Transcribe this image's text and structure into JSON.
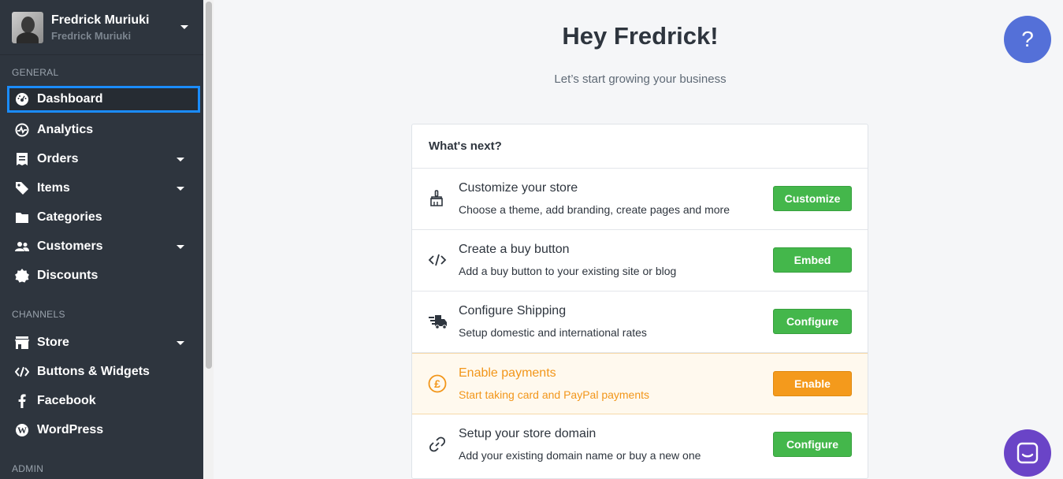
{
  "user": {
    "name": "Fredrick Muriuki",
    "subname": "Fredrick Muriuki"
  },
  "sidebar": {
    "general_label": "GENERAL",
    "channels_label": "CHANNELS",
    "admin_label": "ADMIN",
    "general_items": [
      {
        "label": "Dashboard",
        "icon": "dashboard-icon",
        "active": true
      },
      {
        "label": "Analytics",
        "icon": "analytics-icon"
      },
      {
        "label": "Orders",
        "icon": "orders-icon",
        "dropdown": true
      },
      {
        "label": "Items",
        "icon": "tag-icon",
        "dropdown": true
      },
      {
        "label": "Categories",
        "icon": "folder-icon"
      },
      {
        "label": "Customers",
        "icon": "customers-icon",
        "dropdown": true
      },
      {
        "label": "Discounts",
        "icon": "discount-badge-icon"
      }
    ],
    "channel_items": [
      {
        "label": "Store",
        "icon": "store-icon",
        "dropdown": true
      },
      {
        "label": "Buttons & Widgets",
        "icon": "code-icon"
      },
      {
        "label": "Facebook",
        "icon": "facebook-icon"
      },
      {
        "label": "WordPress",
        "icon": "wordpress-icon"
      }
    ]
  },
  "main": {
    "greeting": "Hey Fredrick!",
    "subtitle": "Let’s start growing your business",
    "card_title": "What's next?",
    "rows": [
      {
        "title": "Customize your store",
        "desc": "Choose a theme, add branding, create pages and more",
        "button": "Customize",
        "icon": "paintbrush-icon"
      },
      {
        "title": "Create a buy button",
        "desc": "Add a buy button to your existing site or blog",
        "button": "Embed",
        "icon": "code-icon"
      },
      {
        "title": "Configure Shipping",
        "desc": "Setup domestic and international rates",
        "button": "Configure",
        "icon": "shipping-truck-icon"
      },
      {
        "title": "Enable payments",
        "desc": "Start taking card and PayPal payments",
        "button": "Enable",
        "icon": "pound-coin-icon",
        "highlight": true
      },
      {
        "title": "Setup your store domain",
        "desc": "Add your existing domain name or buy a new one",
        "button": "Configure",
        "icon": "link-icon"
      }
    ]
  },
  "help_label": "?",
  "colors": {
    "sidebar": "#2e353e",
    "active_outline": "#1a8cff",
    "green": "#44b74b",
    "orange": "#f49a1c",
    "help": "#5470d8",
    "chat": "#6a44c7"
  }
}
